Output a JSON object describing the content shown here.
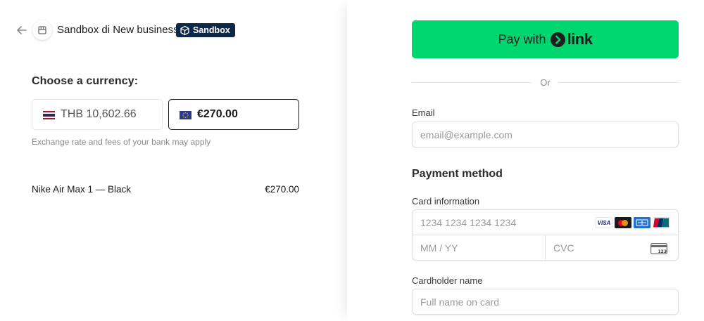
{
  "header": {
    "back_icon": "arrow-left-icon",
    "store_icon": "storefront-icon",
    "business_name": "Sandbox di New business",
    "badge_label": "Sandbox",
    "badge_icon": "cube-icon"
  },
  "currency": {
    "title": "Choose a currency:",
    "options": [
      {
        "code": "THB",
        "label": "THB 10,602.66",
        "flag": "thailand-flag-icon",
        "selected": false
      },
      {
        "code": "EUR",
        "label": "€270.00",
        "flag": "eu-flag-icon",
        "selected": true
      }
    ],
    "note": "Exchange rate and fees of your bank may apply"
  },
  "order": {
    "item_name": "Nike Air Max 1 — Black",
    "item_price": "€270.00"
  },
  "payment": {
    "link_button_prefix": "Pay with",
    "link_logo_text": "link",
    "or_text": "Or",
    "email_label": "Email",
    "email_placeholder": "email@example.com",
    "method_title": "Payment method",
    "card_info_label": "Card information",
    "card_number_placeholder": "1234 1234 1234 1234",
    "expiry_placeholder": "MM / YY",
    "cvc_placeholder": "CVC",
    "card_brands": [
      "VISA",
      "mastercard",
      "amex",
      "unionpay"
    ],
    "cvc_icon_text": "123",
    "cardholder_label": "Cardholder name",
    "cardholder_placeholder": "Full name on card"
  },
  "colors": {
    "link_green": "#00d66f",
    "badge_navy": "#0e2748",
    "border": "#e0e0e0"
  }
}
